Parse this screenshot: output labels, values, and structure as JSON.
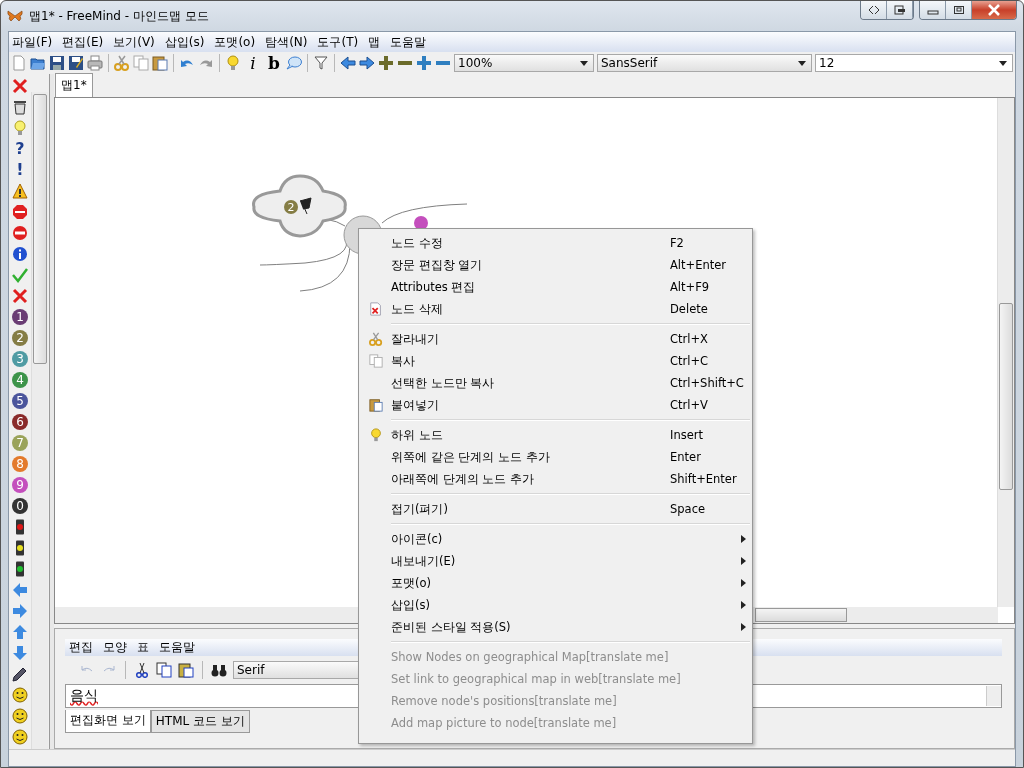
{
  "window": {
    "title": "맵1* - FreeMind - 마인드맵 모드"
  },
  "menu_bar": [
    "파일(F)",
    "편집(E)",
    "보기(V)",
    "삽입(s)",
    "포맷(o)",
    "탐색(N)",
    "도구(T)",
    "맵",
    "도움말"
  ],
  "toolbar": [
    {
      "kind": "page"
    },
    {
      "kind": "folder"
    },
    {
      "kind": "disk"
    },
    {
      "kind": "disk-edit"
    },
    {
      "kind": "printer"
    },
    {
      "kind": "separator"
    },
    {
      "kind": "scissors"
    },
    {
      "kind": "copy"
    },
    {
      "kind": "paste"
    },
    {
      "kind": "separator"
    },
    {
      "kind": "undo"
    },
    {
      "kind": "redo"
    },
    {
      "kind": "separator"
    },
    {
      "kind": "bulb"
    },
    {
      "kind": "italic-letter",
      "label": "i"
    },
    {
      "kind": "bold-letter",
      "label": "b"
    },
    {
      "kind": "bubble"
    },
    {
      "kind": "separator"
    },
    {
      "kind": "filter"
    },
    {
      "kind": "separator"
    },
    {
      "kind": "left"
    },
    {
      "kind": "right"
    },
    {
      "kind": "plus",
      "color": "#6b6b2a"
    },
    {
      "kind": "minus",
      "color": "#6b6b2a"
    },
    {
      "kind": "plus",
      "color": "#2f7fc0"
    },
    {
      "kind": "minus",
      "color": "#2f7fc0"
    }
  ],
  "zoom_combo": {
    "value": "100%"
  },
  "font_combo": {
    "value": "SansSerif"
  },
  "size_combo": {
    "value": "12"
  },
  "tabs": [
    {
      "label": "맵1*",
      "selected": true
    }
  ],
  "icon_bar": [
    {
      "kind": "cross"
    },
    {
      "kind": "trash"
    },
    {
      "kind": "bulb"
    },
    {
      "kind": "glyph",
      "label": "?",
      "color": "#1e3f8f"
    },
    {
      "kind": "glyph",
      "label": "!",
      "color": "#1e3f8f"
    },
    {
      "kind": "warning"
    },
    {
      "kind": "stop"
    },
    {
      "kind": "no-entry"
    },
    {
      "kind": "info"
    },
    {
      "kind": "check"
    },
    {
      "kind": "cross"
    },
    {
      "kind": "number",
      "label": "1",
      "color": "#6a3c74"
    },
    {
      "kind": "number",
      "label": "2",
      "color": "#857d45"
    },
    {
      "kind": "number",
      "label": "3",
      "color": "#4f9ba3"
    },
    {
      "kind": "number",
      "label": "4",
      "color": "#3d944a"
    },
    {
      "kind": "number",
      "label": "5",
      "color": "#4b559c"
    },
    {
      "kind": "number",
      "label": "6",
      "color": "#8a2b2b"
    },
    {
      "kind": "number",
      "label": "7",
      "color": "#9aa35a"
    },
    {
      "kind": "number",
      "label": "8",
      "color": "#e37a2c"
    },
    {
      "kind": "number",
      "label": "9",
      "color": "#c44fbd"
    },
    {
      "kind": "number",
      "label": "0",
      "color": "#333333"
    },
    {
      "kind": "light",
      "color": "#e01818"
    },
    {
      "kind": "light",
      "color": "#e8e020"
    },
    {
      "kind": "light",
      "color": "#20c030"
    },
    {
      "kind": "left"
    },
    {
      "kind": "right"
    },
    {
      "kind": "up"
    },
    {
      "kind": "down"
    },
    {
      "kind": "pencil"
    },
    {
      "kind": "smiley"
    },
    {
      "kind": "smiley"
    },
    {
      "kind": "smiley"
    }
  ],
  "map": {
    "cloud_node_number": "2"
  },
  "context_menu": [
    {
      "kind": "plain",
      "label": "노드 수정",
      "shortcut": "F2",
      "disabled": false
    },
    {
      "kind": "plain",
      "label": "장문 편집창 열기",
      "shortcut": "Alt+Enter",
      "disabled": false
    },
    {
      "kind": "plain",
      "label": "Attributes 편집",
      "shortcut": "Alt+F9",
      "disabled": false
    },
    {
      "kind": "delete",
      "label": "노드 삭제",
      "shortcut": "Delete",
      "disabled": false
    },
    {
      "kind": "separator"
    },
    {
      "kind": "cut",
      "label": "잘라내기",
      "shortcut": "Ctrl+X",
      "disabled": false
    },
    {
      "kind": "copy",
      "label": "복사",
      "shortcut": "Ctrl+C",
      "disabled": false
    },
    {
      "kind": "plain",
      "label": "선택한 노드만 복사",
      "shortcut": "Ctrl+Shift+C",
      "disabled": false
    },
    {
      "kind": "paste",
      "label": "붙여넣기",
      "shortcut": "Ctrl+V",
      "disabled": false
    },
    {
      "kind": "separator"
    },
    {
      "kind": "child",
      "label": "하위 노드",
      "shortcut": "Insert",
      "disabled": false
    },
    {
      "kind": "plain",
      "label": "위쪽에 같은 단계의 노드 추가",
      "shortcut": "Enter",
      "disabled": false
    },
    {
      "kind": "plain",
      "label": "아래쪽에 단계의 노드 추가",
      "shortcut": "Shift+Enter",
      "disabled": false
    },
    {
      "kind": "separator"
    },
    {
      "kind": "plain",
      "label": "접기(펴기)",
      "shortcut": "Space",
      "disabled": false
    },
    {
      "kind": "separator"
    },
    {
      "kind": "submenu",
      "label": "아이콘(c)",
      "disabled": false
    },
    {
      "kind": "submenu",
      "label": "내보내기(E)",
      "disabled": false
    },
    {
      "kind": "submenu",
      "label": "포맷(o)",
      "disabled": false
    },
    {
      "kind": "submenu",
      "label": "삽입(s)",
      "disabled": false
    },
    {
      "kind": "submenu",
      "label": "준비된 스타일 적용(S)",
      "disabled": false
    },
    {
      "kind": "separator"
    },
    {
      "kind": "plain",
      "label": "Show Nodes on geographical Map[translate me]",
      "disabled": true
    },
    {
      "kind": "plain",
      "label": "Set link to geographical map in web[translate me]",
      "disabled": true
    },
    {
      "kind": "plain",
      "label": "Remove node's positions[translate me]",
      "disabled": true
    },
    {
      "kind": "plain",
      "label": "Add map picture to node[translate me]",
      "disabled": true
    }
  ],
  "note_editor": {
    "menu": [
      "편집",
      "모양",
      "표",
      "도움말"
    ],
    "toolbar": [
      {
        "kind": "undo",
        "disabled": true
      },
      {
        "kind": "redo",
        "disabled": true
      },
      {
        "kind": "separator"
      },
      {
        "kind": "scissors",
        "disabled": false
      },
      {
        "kind": "copy",
        "disabled": false
      },
      {
        "kind": "paste",
        "disabled": false
      },
      {
        "kind": "separator"
      },
      {
        "kind": "binoculars",
        "disabled": false
      }
    ],
    "font_combo": {
      "value": "Serif"
    },
    "text": "음식",
    "tabs": [
      {
        "label": "편집화면 보기",
        "selected": true
      },
      {
        "label": "HTML 코드 보기",
        "selected": false
      }
    ]
  }
}
